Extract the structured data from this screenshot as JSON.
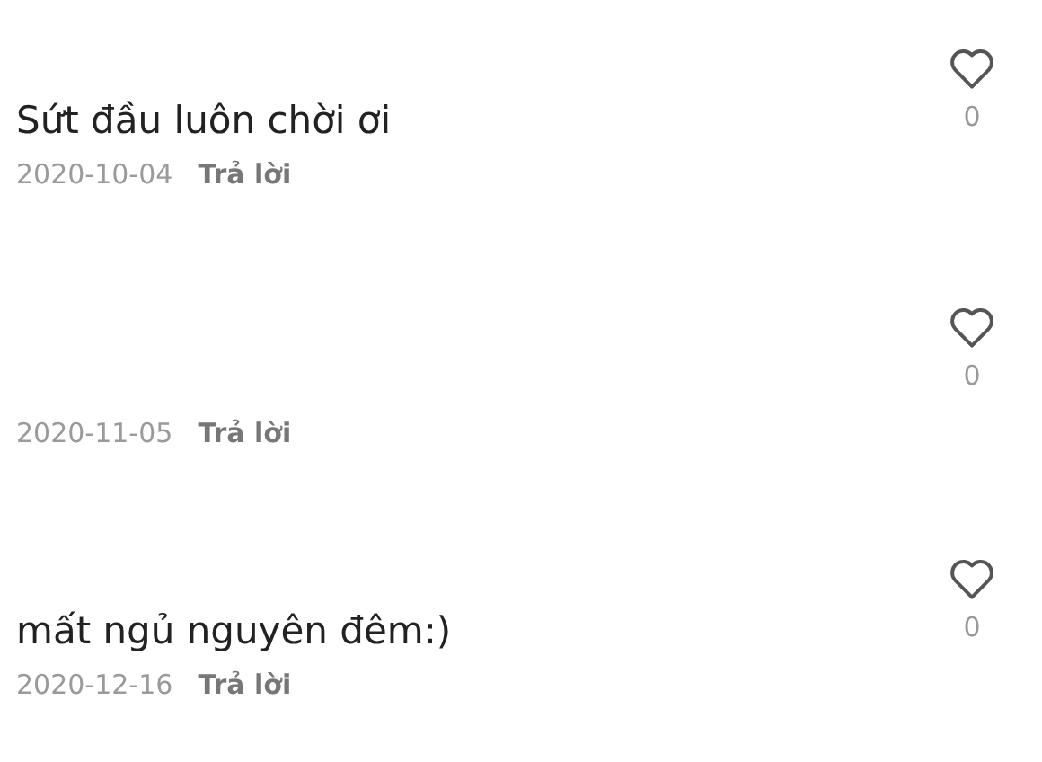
{
  "comments": [
    {
      "text": "Sứt đầu luôn chời ơi",
      "date": "2020-10-04",
      "reply": "Trả lời",
      "likes": "0"
    },
    {
      "date": "2020-11-05",
      "reply": "Trả lời",
      "likes": "0"
    },
    {
      "text": "mất ngủ nguyên đêm:)",
      "date": "2020-12-16",
      "reply": "Trả lời",
      "likes": "0"
    }
  ]
}
